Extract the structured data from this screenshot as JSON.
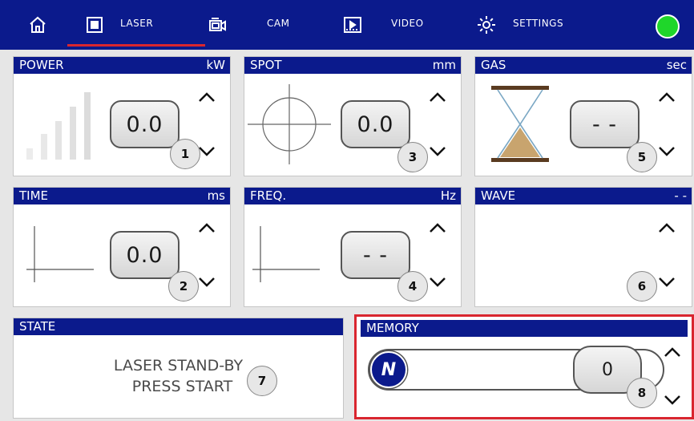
{
  "nav": {
    "items": [
      {
        "icon": "home-icon",
        "label": ""
      },
      {
        "icon": "laser-grid-icon",
        "label": "LASER",
        "active": true
      },
      {
        "icon": "camera-icon",
        "label": "CAM"
      },
      {
        "icon": "video-icon",
        "label": "VIDEO"
      },
      {
        "icon": "gear-icon",
        "label": "SETTINGS"
      }
    ],
    "status_color": "#1fd62a",
    "active_underline_color": "#d9262f"
  },
  "panels": {
    "power": {
      "title": "POWER",
      "unit": "kW",
      "value": "0.0",
      "badge": "1",
      "glyph": "signal-bars-icon"
    },
    "spot": {
      "title": "SPOT",
      "unit": "mm",
      "value": "0.0",
      "badge": "3",
      "glyph": "crosshair-icon"
    },
    "gas": {
      "title": "GAS",
      "unit": "sec",
      "value": "- -",
      "badge": "5",
      "glyph": "hourglass-icon"
    },
    "time": {
      "title": "TIME",
      "unit": "ms",
      "value": "0.0",
      "badge": "2",
      "glyph": "time-axis-icon"
    },
    "freq": {
      "title": "FREQ.",
      "unit": "Hz",
      "value": "- -",
      "badge": "4",
      "glyph": "frequency-axis-icon"
    },
    "wave": {
      "title": "WAVE",
      "unit": "- -",
      "badge": "6"
    },
    "state": {
      "title": "STATE",
      "line1": "LASER STAND-BY",
      "line2": "PRESS START",
      "badge": "7"
    },
    "memory": {
      "title": "MEMORY",
      "toggle_label": "N",
      "value": "0",
      "badge": "8",
      "highlight_color": "#d9262f"
    }
  },
  "colors": {
    "header_blue": "#0b1a8c",
    "accent_red": "#d9262f",
    "status_green": "#1fd62a"
  }
}
